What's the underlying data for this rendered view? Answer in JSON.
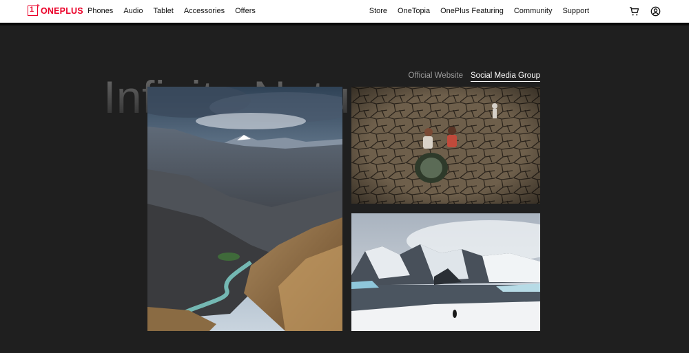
{
  "brand": "ONEPLUS",
  "nav_left": [
    "Phones",
    "Audio",
    "Tablet",
    "Accessories",
    "Offers"
  ],
  "nav_right": [
    "Store",
    "OneTopia",
    "OnePlus Featuring",
    "Community",
    "Support"
  ],
  "icons": {
    "cart": "cart-icon",
    "account": "user-account-icon"
  },
  "hero": {
    "title": "Infinite Nature"
  },
  "tabs": [
    {
      "label": "Official Website",
      "active": false
    },
    {
      "label": "Social Media Group",
      "active": true
    }
  ],
  "colors": {
    "brand": "#eb0028",
    "background": "#1f1f1f"
  },
  "gallery": [
    "mountain-valley-river-photo",
    "cracked-earth-photo",
    "antarctic-glacier-photo"
  ]
}
